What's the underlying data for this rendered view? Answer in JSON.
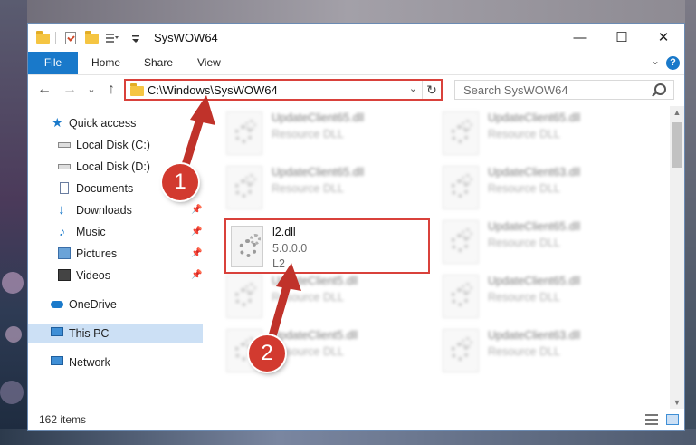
{
  "window": {
    "title": "SysWOW64",
    "min": "—",
    "max": "☐",
    "close": "✕"
  },
  "ribbon": {
    "file": "File",
    "tabs": [
      "Home",
      "Share",
      "View"
    ],
    "expand": "⌄",
    "help": "?"
  },
  "nav": {
    "back": "←",
    "forward": "→",
    "recent": "⌄",
    "up": "↑",
    "address": "C:\\Windows\\SysWOW64",
    "address_drop": "⌄",
    "refresh": "↻",
    "search_placeholder": "Search SysWOW64"
  },
  "sidebar": {
    "items": [
      {
        "label": "Quick access",
        "icon": "star-icon"
      },
      {
        "label": "Local Disk (C:)",
        "icon": "drive-icon"
      },
      {
        "label": "Local Disk (D:)",
        "icon": "drive-icon"
      },
      {
        "label": "Documents",
        "icon": "document-icon"
      },
      {
        "label": "Downloads",
        "icon": "download-icon"
      },
      {
        "label": "Music",
        "icon": "music-icon"
      },
      {
        "label": "Pictures",
        "icon": "pictures-icon"
      },
      {
        "label": "Videos",
        "icon": "videos-icon"
      },
      {
        "label": "OneDrive",
        "icon": "cloud-icon"
      },
      {
        "label": "This PC",
        "icon": "computer-icon"
      },
      {
        "label": "Network",
        "icon": "network-icon"
      }
    ],
    "pin": "📌"
  },
  "files": {
    "highlighted": {
      "name": "l2.dll",
      "version": "5.0.0.0",
      "description": "L2"
    },
    "left_column": [
      {
        "name": "UpdateClient65.dll",
        "type": "Resource DLL"
      },
      {
        "name": "UpdateClient65.dll",
        "type": "Resource DLL"
      },
      {
        "name": "UpdateClient5.dll",
        "type": "Resource DLL"
      },
      {
        "name": "UpdateClient5.dll",
        "type": "Resource DLL"
      }
    ],
    "right_column": [
      {
        "name": "UpdateClient65.dll",
        "type": "Resource DLL"
      },
      {
        "name": "UpdateClient63.dll",
        "type": "Resource DLL"
      },
      {
        "name": "UpdateClient65.dll",
        "type": "Resource DLL"
      },
      {
        "name": "UpdateClient65.dll",
        "type": "Resource DLL"
      },
      {
        "name": "UpdateClient63.dll",
        "type": "Resource DLL"
      }
    ]
  },
  "status": {
    "item_count": "162 items"
  },
  "callouts": {
    "step1": "1",
    "step2": "2"
  },
  "colors": {
    "accent": "#1979ca",
    "highlight": "#d9413b",
    "callout": "#d23a2f"
  }
}
